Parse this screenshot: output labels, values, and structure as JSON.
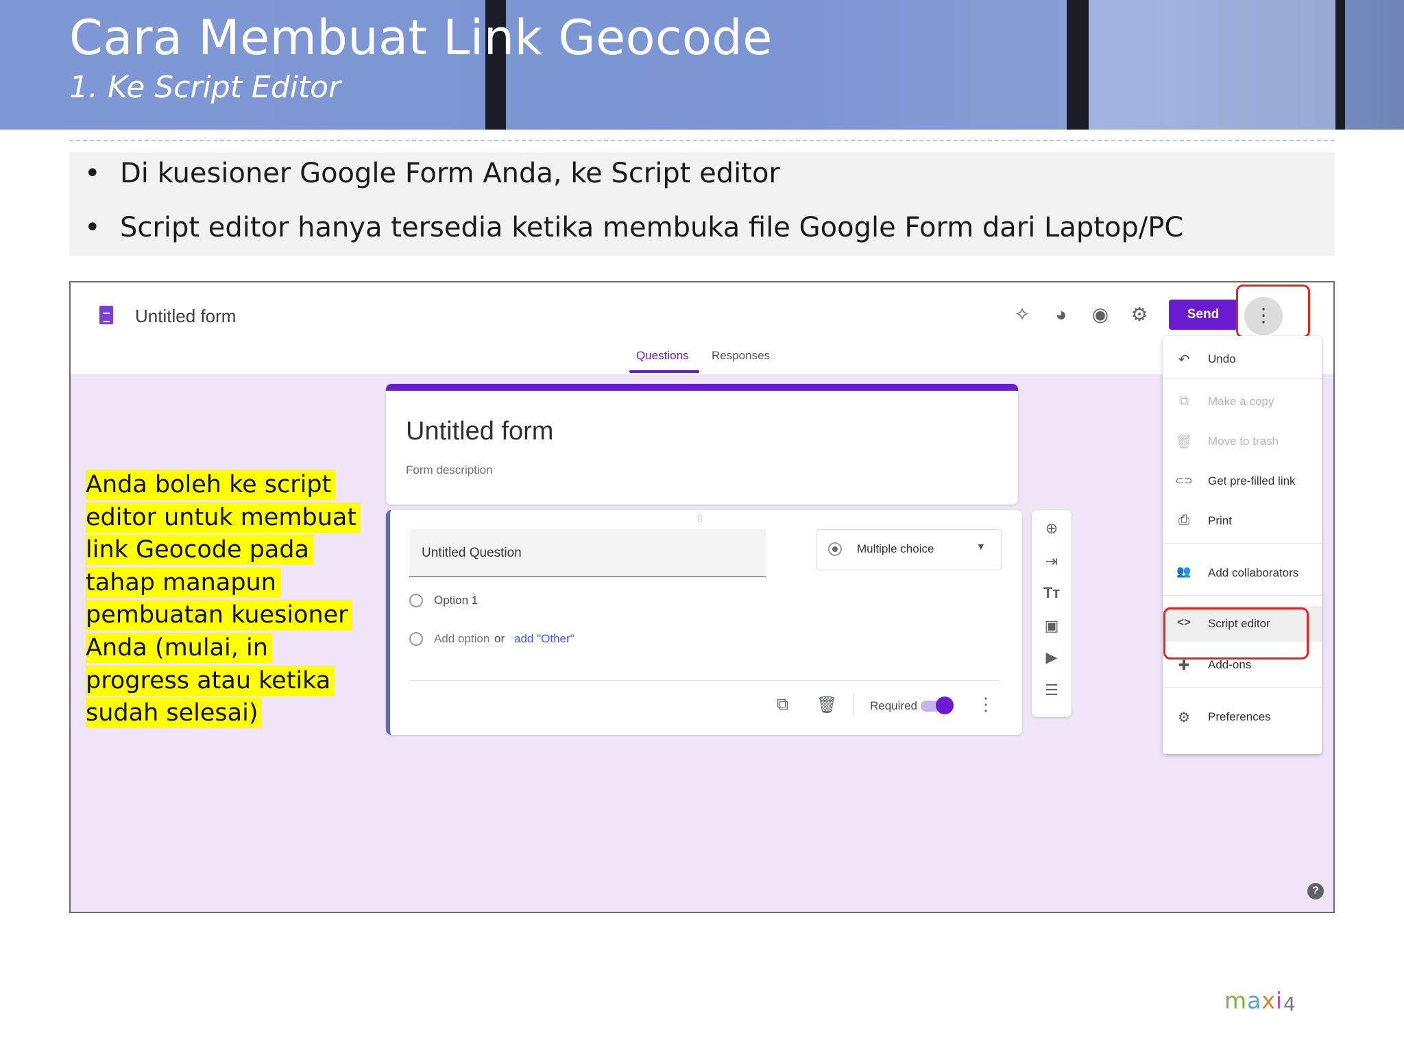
{
  "slide": {
    "title": "Cara Membuat Link Geocode",
    "subtitle": "1. Ke Script Editor",
    "bullets": [
      "Di kuesioner Google Form Anda, ke Script editor",
      "Script editor hanya tersedia ketika membuka file Google Form dari Laptop/PC"
    ],
    "note": "Anda boleh ke script editor untuk membuat link Geocode pada tahap manapun pembuatan kuesioner Anda  (mulai, in progress atau ketika sudah selesai)",
    "logo": "maxi",
    "page_number": "4"
  },
  "form_app": {
    "title": "Untitled form",
    "toolbar_icons": [
      "addon-icon",
      "palette-icon",
      "eye-icon",
      "gear-icon"
    ],
    "send_label": "Send",
    "more_icon": "⋮",
    "tabs": [
      "Questions",
      "Responses"
    ],
    "active_tab": "Questions",
    "form_title": "Untitled form",
    "form_description": "Form description",
    "question": "Untitled Question",
    "question_type": "Multiple choice",
    "option1": "Option 1",
    "add_option": "Add option",
    "or": "or",
    "add_other": "add \"Other\"",
    "required_label": "Required",
    "accent_color": "#6a1bd0",
    "highlight_color": "#e0261f",
    "menu": [
      {
        "label": "Undo",
        "icon": "undo-icon",
        "glyph": "↶",
        "disabled": false
      },
      {
        "label": "Make a copy",
        "icon": "copy-icon",
        "glyph": "⧉",
        "disabled": true
      },
      {
        "label": "Move to trash",
        "icon": "trash-icon",
        "glyph": "🗑",
        "disabled": true
      },
      {
        "label": "Get pre-filled link",
        "icon": "link-icon",
        "glyph": "⊂⊃",
        "disabled": false
      },
      {
        "label": "Print",
        "icon": "print-icon",
        "glyph": "⎙",
        "disabled": false
      },
      {
        "label": "Add collaborators",
        "icon": "people-icon",
        "glyph": "👥",
        "disabled": false
      },
      {
        "label": "Script editor",
        "icon": "code-icon",
        "glyph": "<>",
        "disabled": false
      },
      {
        "label": "Add-ons",
        "icon": "puzzle-icon",
        "glyph": "✚",
        "disabled": false
      },
      {
        "label": "Preferences",
        "icon": "preferences-icon",
        "glyph": "⚙",
        "disabled": false
      }
    ]
  }
}
